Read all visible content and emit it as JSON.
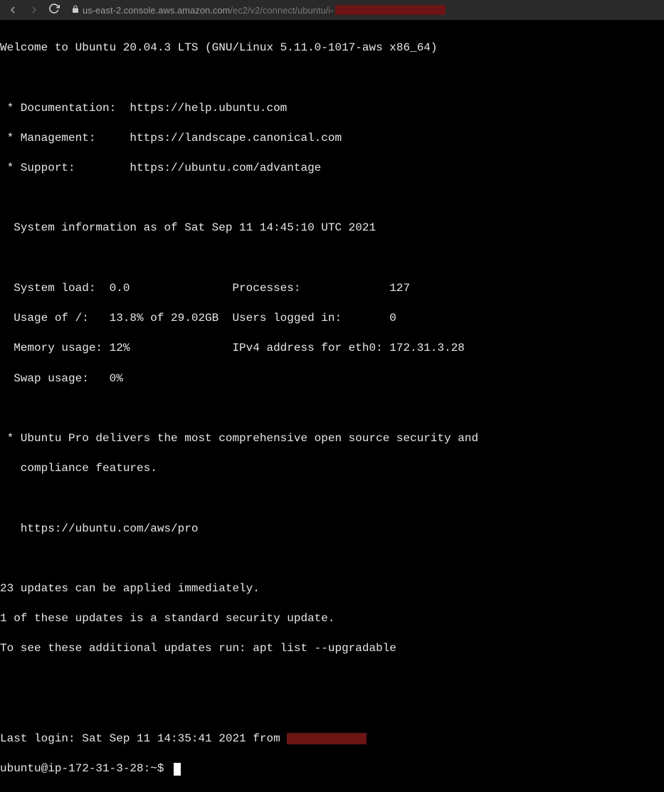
{
  "browser": {
    "url_host": "us-east-2.console.aws.amazon.com",
    "url_path": "/ec2/v2/connect/ubuntu/i-"
  },
  "motd": {
    "welcome": "Welcome to Ubuntu 20.04.3 LTS (GNU/Linux 5.11.0-1017-aws x86_64)",
    "doc_line": " * Documentation:  https://help.ubuntu.com",
    "mgmt_line": " * Management:     https://landscape.canonical.com",
    "support_line": " * Support:        https://ubuntu.com/advantage",
    "sysinfo_header": "  System information as of Sat Sep 11 14:45:10 UTC 2021",
    "row1": "  System load:  0.0               Processes:             127",
    "row2": "  Usage of /:   13.8% of 29.02GB  Users logged in:       0",
    "row3": "  Memory usage: 12%               IPv4 address for eth0: 172.31.3.28",
    "row4": "  Swap usage:   0%",
    "pro1": " * Ubuntu Pro delivers the most comprehensive open source security and",
    "pro2": "   compliance features.",
    "pro3": "   https://ubuntu.com/aws/pro",
    "updates1": "23 updates can be applied immediately.",
    "updates2": "1 of these updates is a standard security update.",
    "updates3": "To see these additional updates run: apt list --upgradable",
    "lastlogin_prefix": "Last login: Sat Sep 11 14:35:41 2021 from ",
    "prompt": "ubuntu@ip-172-31-3-28:~$ "
  }
}
